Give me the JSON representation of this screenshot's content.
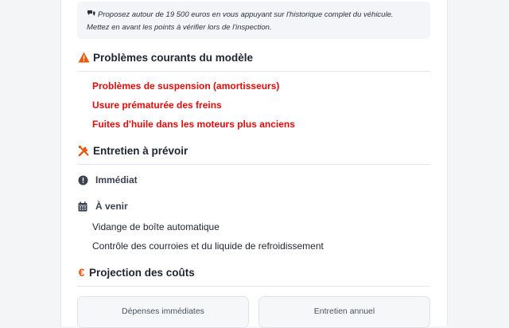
{
  "tip": {
    "icon": "chat-bubbles-icon",
    "line1": "Proposez autour de 19 500 euros en vous appuyant sur l'historique complet du véhicule.",
    "line2": "Mettez en avant les points à vérifier lors de l'inspection."
  },
  "problems": {
    "title": "Problèmes courants du modèle",
    "icon": "warning-triangle-icon",
    "items": [
      "Problèmes de suspension (amortisseurs)",
      "Usure prématurée des freins",
      "Fuites d'huile dans les moteurs plus anciens"
    ]
  },
  "maintenance": {
    "title": "Entretien à prévoir",
    "icon": "tools-icon",
    "immediate_label": "Immédiat",
    "upcoming_label": "À venir",
    "upcoming_items": [
      "Vidange de boîte automatique",
      "Contrôle des courroies et du liquide de refroidissement"
    ]
  },
  "costs": {
    "title": "Projection des coûts",
    "icon": "euro-icon",
    "euro_symbol": "€",
    "boxes": [
      "Dépenses immédiates",
      "Entretien annuel"
    ]
  },
  "colors": {
    "accent_orange": "#e8590c",
    "problem_red": "#e30b0b"
  }
}
